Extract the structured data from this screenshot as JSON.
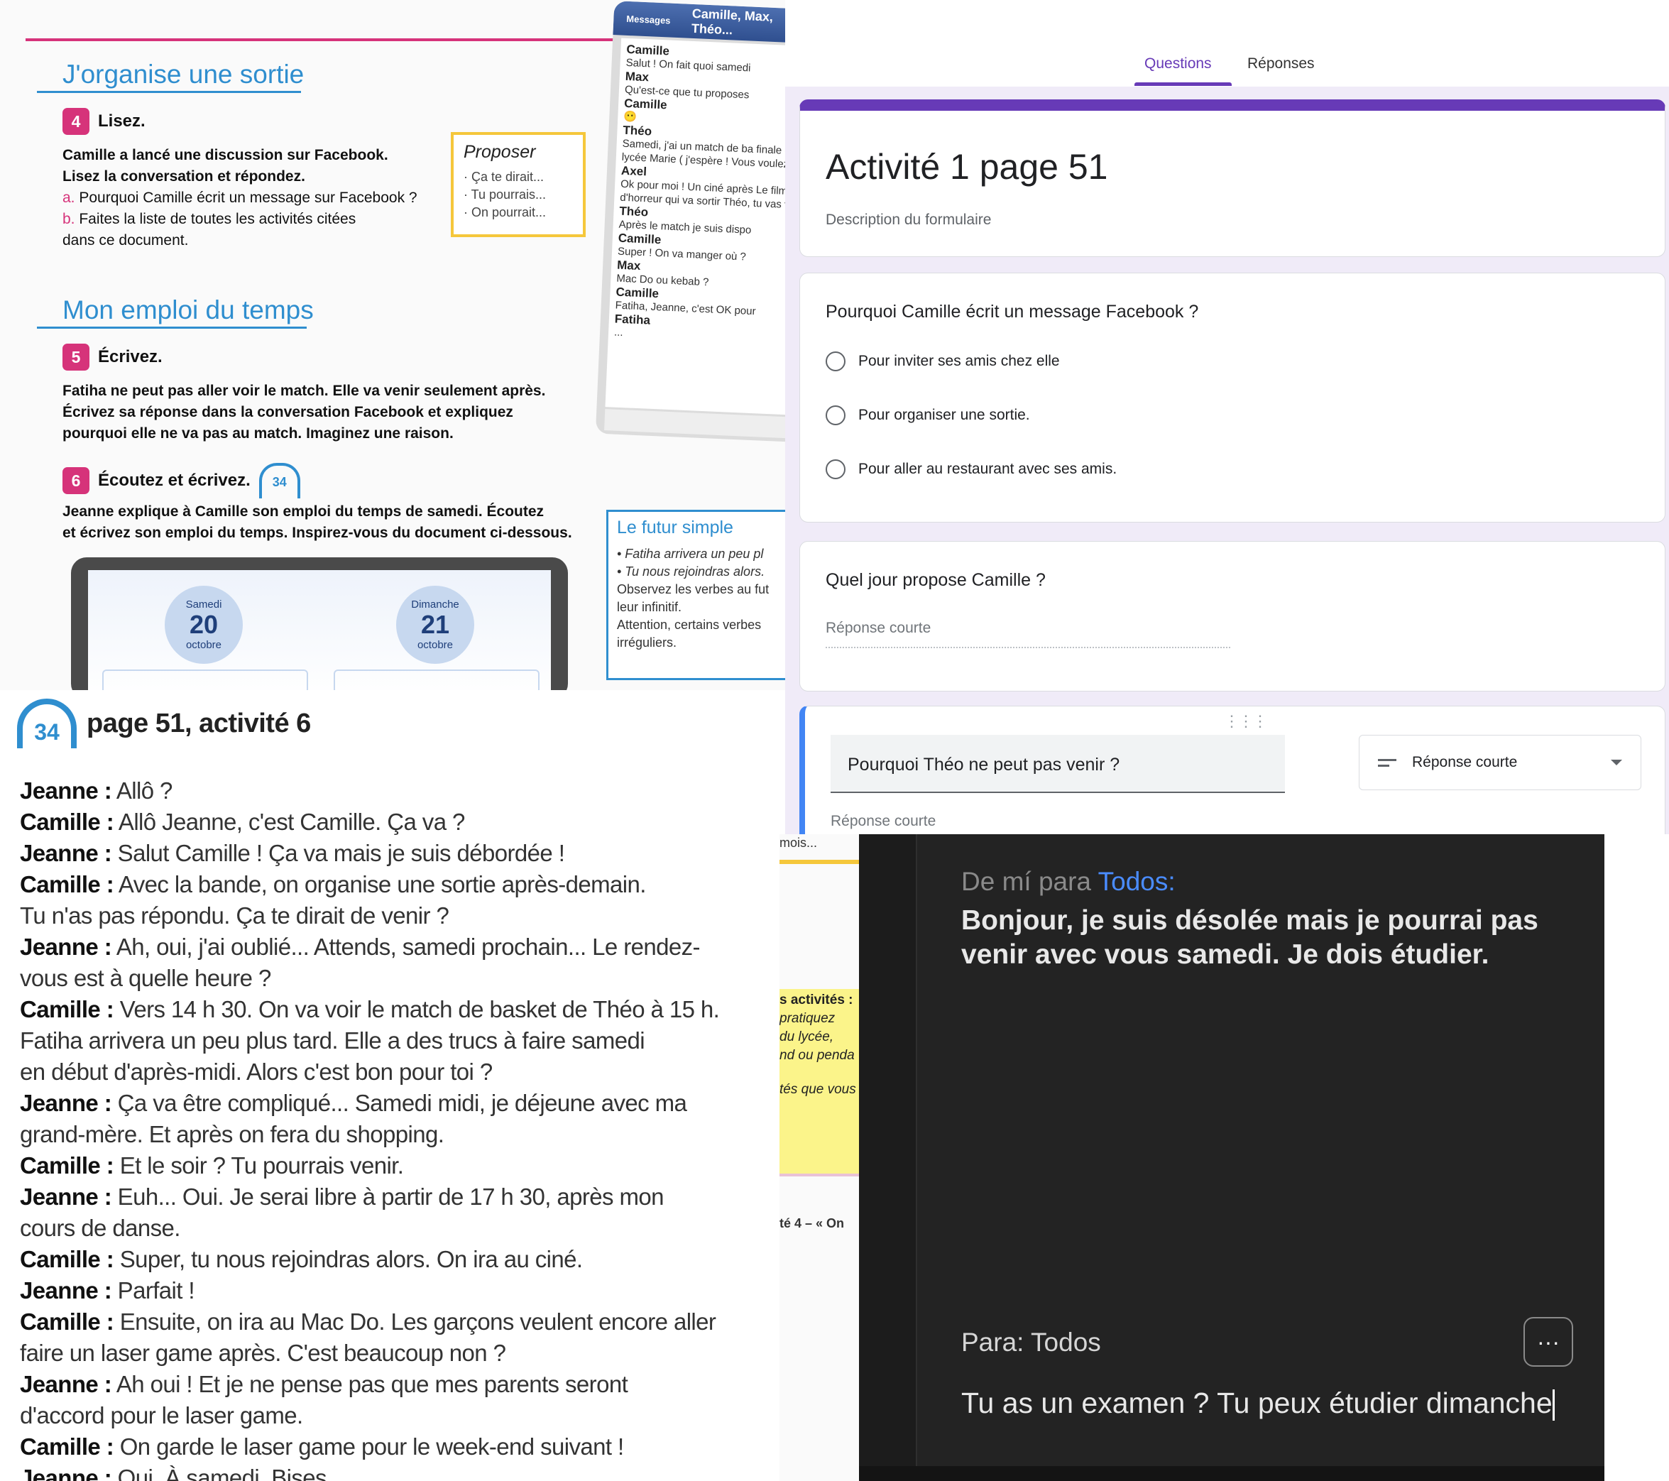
{
  "textbook": {
    "section1_title": "J'organise une sortie",
    "step4": {
      "num": "4",
      "label": "Lisez."
    },
    "step4_lines": [
      {
        "bold": "Camille a lancé une discussion sur Facebook.",
        "plain": ""
      },
      {
        "bold": "Lisez la conversation et répondez.",
        "plain": ""
      },
      {
        "letter": "a.",
        "plain": "Pourquoi Camille écrit un message sur Facebook ?"
      },
      {
        "letter": "b.",
        "plain": "Faites la liste de toutes les activités citées"
      },
      {
        "plain": "dans ce document."
      }
    ],
    "proposer": {
      "title": "Proposer",
      "items": [
        "· Ça te dirait...",
        "· Tu pourrais...",
        "· On pourrait..."
      ]
    },
    "phone": {
      "header": [
        "Messages",
        "Camille, Max, Théo..."
      ],
      "messages": [
        {
          "n": "Camille",
          "m": "Salut ! On fait quoi samedi"
        },
        {
          "n": "Max",
          "m": "Qu'est-ce que tu proposes"
        },
        {
          "n": "Camille",
          "m": "😶"
        },
        {
          "n": "Théo",
          "m": "Samedi, j'ai un match de ba finale contre le lycée Marie ( j'espère ! Vous voulez venir"
        },
        {
          "n": "Axel",
          "m": "Ok pour moi ! Un ciné après Le film d'horreur qui va sortir Théo, tu vas venir ?"
        },
        {
          "n": "Théo",
          "m": "Après le match je suis dispo"
        },
        {
          "n": "Camille",
          "m": "Super ! On va manger où ?"
        },
        {
          "n": "Max",
          "m": "Mac Do ou kebab ?"
        },
        {
          "n": "Camille",
          "m": "Fatiha, Jeanne, c'est OK pour"
        },
        {
          "n": "Fatiha",
          "m": "..."
        }
      ]
    },
    "section2_title": "Mon emploi du temps",
    "step5": {
      "num": "5",
      "label": "Écrivez."
    },
    "step5_lines": [
      "Fatiha ne peut pas aller voir le match. Elle va venir seulement après.",
      "Écrivez sa réponse dans la conversation Facebook et expliquez",
      "pourquoi elle ne va pas au match. Imaginez une raison."
    ],
    "step6": {
      "num": "6",
      "label": "Écoutez et écrivez.",
      "audio": "34"
    },
    "step6_lines": [
      "Jeanne explique à Camille son emploi du temps de samedi. Écoutez",
      "et écrivez son emploi du temps. Inspirez-vous du document ci-dessous."
    ],
    "futur": {
      "title": "Le futur simple",
      "examples": [
        "• Fatiha arrivera un peu pl",
        "• Tu nous rejoindras alors."
      ],
      "notes": [
        "Observez les verbes au fut",
        "leur infinitif.",
        "Attention, certains verbes",
        "irréguliers."
      ]
    },
    "days": [
      {
        "name": "Samedi",
        "num": "20",
        "month": "octobre"
      },
      {
        "name": "Dimanche",
        "num": "21",
        "month": "octobre"
      }
    ]
  },
  "transcript": {
    "audio_num": "34",
    "title": "page 51, activité 6",
    "lines": [
      {
        "sp": "Jeanne :",
        "t": " Allô ?"
      },
      {
        "sp": "Camille :",
        "t": " Allô Jeanne, c'est Camille. Ça va ?"
      },
      {
        "sp": "Jeanne :",
        "t": " Salut Camille ! Ça va mais je suis débordée !"
      },
      {
        "sp": "Camille :",
        "t": " Avec la bande, on organise une sortie après-demain."
      },
      {
        "sp": "",
        "t": "Tu n'as pas répondu. Ça te dirait de venir ?"
      },
      {
        "sp": "Jeanne :",
        "t": " Ah, oui, j'ai oublié... Attends, samedi prochain... Le rendez-"
      },
      {
        "sp": "",
        "t": "vous est à quelle heure ?"
      },
      {
        "sp": "Camille :",
        "t": " Vers 14 h 30. On va voir le match de basket de Théo à 15 h."
      },
      {
        "sp": "",
        "t": "Fatiha arrivera un peu plus tard. Elle a des trucs à faire samedi"
      },
      {
        "sp": "",
        "t": "en début d'après-midi. Alors c'est bon pour toi ?"
      },
      {
        "sp": "Jeanne :",
        "t": " Ça va être compliqué... Samedi midi, je déjeune avec ma"
      },
      {
        "sp": "",
        "t": "grand-mère. Et après on fera du shopping."
      },
      {
        "sp": "Camille :",
        "t": " Et le soir ? Tu pourrais venir."
      },
      {
        "sp": "Jeanne :",
        "t": " Euh... Oui. Je serai libre à partir de 17 h 30, après mon"
      },
      {
        "sp": "",
        "t": "cours de danse."
      },
      {
        "sp": "Camille :",
        "t": " Super, tu nous rejoindras alors. On ira au ciné."
      },
      {
        "sp": "Jeanne :",
        "t": " Parfait !"
      },
      {
        "sp": "Camille :",
        "t": " Ensuite, on ira au Mac Do. Les garçons veulent encore aller"
      },
      {
        "sp": "",
        "t": "faire un laser game après. C'est beaucoup non ?"
      },
      {
        "sp": "Jeanne :",
        "t": " Ah oui ! Et je ne pense pas que mes parents seront"
      },
      {
        "sp": "",
        "t": "d'accord pour le laser game."
      },
      {
        "sp": "Camille :",
        "t": " On garde le laser game pour le week-end suivant !"
      },
      {
        "sp": "Jeanne :",
        "t": " Oui. À samedi. Bises."
      }
    ]
  },
  "forms": {
    "tabs": [
      "Questions",
      "Réponses"
    ],
    "title": "Activité 1 page 51",
    "description": "Description du formulaire",
    "q1": {
      "text": "Pourquoi Camille écrit un message Facebook ?",
      "options": [
        "Pour inviter ses amis chez elle",
        "Pour organiser une sortie.",
        "Pour aller au restaurant avec ses amis."
      ]
    },
    "q2": {
      "text": "Quel jour propose Camille ?",
      "placeholder": "Réponse courte"
    },
    "q3": {
      "text": "Pourquoi Théo ne peut pas venir ?",
      "type": "Réponse courte",
      "placeholder": "Réponse courte"
    },
    "accent": "#673ab7"
  },
  "strip": {
    "top": "mois...",
    "sticky": [
      "s activités :",
      "pratiquez",
      "du lycée,",
      "nd ou penda",
      "tés que vous"
    ],
    "bottom": "té 4 – « On"
  },
  "chat": {
    "from_prefix": "De mí para ",
    "from_to": "Todos:",
    "message": "Bonjour, je suis désolée mais je pourrai pas venir avec vous samedi. Je dois étudier.",
    "para": "Para: Todos",
    "more": "···",
    "input": "Tu as un examen ? Tu peux étudier dimanche"
  }
}
